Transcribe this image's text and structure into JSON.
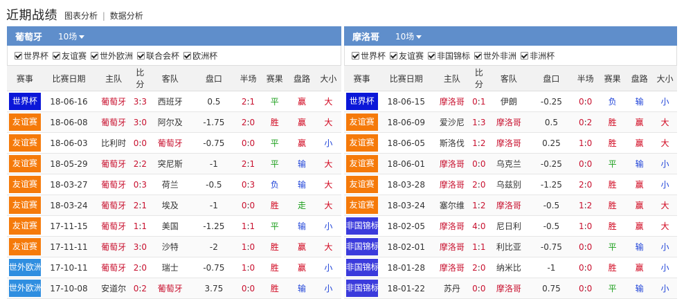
{
  "header": {
    "title": "近期战绩",
    "link1": "图表分析",
    "separator": "|",
    "link2": "数据分析"
  },
  "colors": {
    "header_bar": "#5f8ecb",
    "world_cup": "#0b17d8",
    "friendly": "#f57a0a",
    "wc_qual_europe": "#2f8ee0",
    "african_nations": "#3b3bdc",
    "win": "#d0021b",
    "draw": "#1a9e1a",
    "loss": "#1f43d8"
  },
  "panels": [
    {
      "team": "葡萄牙",
      "matches_label": "10场",
      "filters": [
        "世界杯",
        "友谊赛",
        "世外欧洲",
        "联合会杯",
        "欧洲杯"
      ],
      "columns": [
        "赛事",
        "比赛日期",
        "主队",
        "比分",
        "客队",
        "盘口",
        "半场",
        "赛果",
        "盘路",
        "大小"
      ],
      "rows": [
        {
          "league": "世界杯",
          "lc": "world_cup",
          "date": "18-06-16",
          "home": "葡萄牙",
          "hh": true,
          "s1": "3",
          "s2": "3",
          "away": "西班牙",
          "ah": false,
          "line": "0.5",
          "h1": "2",
          "h2": "1",
          "res": "平",
          "rc": "draw",
          "hcp": "赢",
          "hc": "win",
          "ou": "大",
          "oc": "win"
        },
        {
          "league": "友谊赛",
          "lc": "friendly",
          "date": "18-06-08",
          "home": "葡萄牙",
          "hh": true,
          "s1": "3",
          "s2": "0",
          "away": "阿尔及",
          "ah": false,
          "line": "-1.75",
          "h1": "2",
          "h2": "0",
          "res": "胜",
          "rc": "win",
          "hcp": "赢",
          "hc": "win",
          "ou": "大",
          "oc": "win"
        },
        {
          "league": "友谊赛",
          "lc": "friendly",
          "date": "18-06-03",
          "home": "比利时",
          "hh": false,
          "s1": "0",
          "s2": "0",
          "away": "葡萄牙",
          "ah": true,
          "line": "-0.75",
          "h1": "0",
          "h2": "0",
          "res": "平",
          "rc": "draw",
          "hcp": "赢",
          "hc": "win",
          "ou": "小",
          "oc": "loss"
        },
        {
          "league": "友谊赛",
          "lc": "friendly",
          "date": "18-05-29",
          "home": "葡萄牙",
          "hh": true,
          "s1": "2",
          "s2": "2",
          "away": "突尼斯",
          "ah": false,
          "line": "-1",
          "h1": "2",
          "h2": "1",
          "res": "平",
          "rc": "draw",
          "hcp": "输",
          "hc": "loss",
          "ou": "大",
          "oc": "win"
        },
        {
          "league": "友谊赛",
          "lc": "friendly",
          "date": "18-03-27",
          "home": "葡萄牙",
          "hh": true,
          "s1": "0",
          "s2": "3",
          "away": "荷兰",
          "ah": false,
          "line": "-0.5",
          "h1": "0",
          "h2": "3",
          "res": "负",
          "rc": "loss",
          "hcp": "输",
          "hc": "loss",
          "ou": "大",
          "oc": "win"
        },
        {
          "league": "友谊赛",
          "lc": "friendly",
          "date": "18-03-24",
          "home": "葡萄牙",
          "hh": true,
          "s1": "2",
          "s2": "1",
          "away": "埃及",
          "ah": false,
          "line": "-1",
          "h1": "0",
          "h2": "0",
          "res": "胜",
          "rc": "win",
          "hcp": "走",
          "hc": "draw",
          "ou": "大",
          "oc": "win"
        },
        {
          "league": "友谊赛",
          "lc": "friendly",
          "date": "17-11-15",
          "home": "葡萄牙",
          "hh": true,
          "s1": "1",
          "s2": "1",
          "away": "美国",
          "ah": false,
          "line": "-1.25",
          "h1": "1",
          "h2": "1",
          "res": "平",
          "rc": "draw",
          "hcp": "输",
          "hc": "loss",
          "ou": "小",
          "oc": "loss"
        },
        {
          "league": "友谊赛",
          "lc": "friendly",
          "date": "17-11-11",
          "home": "葡萄牙",
          "hh": true,
          "s1": "3",
          "s2": "0",
          "away": "沙特",
          "ah": false,
          "line": "-2",
          "h1": "1",
          "h2": "0",
          "res": "胜",
          "rc": "win",
          "hcp": "赢",
          "hc": "win",
          "ou": "大",
          "oc": "win"
        },
        {
          "league": "世外欧洲",
          "lc": "wc_qual_europe",
          "date": "17-10-11",
          "home": "葡萄牙",
          "hh": true,
          "s1": "2",
          "s2": "0",
          "away": "瑞士",
          "ah": false,
          "line": "-0.75",
          "h1": "1",
          "h2": "0",
          "res": "胜",
          "rc": "win",
          "hcp": "赢",
          "hc": "win",
          "ou": "小",
          "oc": "loss"
        },
        {
          "league": "世外欧洲",
          "lc": "wc_qual_europe",
          "date": "17-10-08",
          "home": "安道尔",
          "hh": false,
          "s1": "0",
          "s2": "2",
          "away": "葡萄牙",
          "ah": true,
          "line": "3.75",
          "h1": "0",
          "h2": "0",
          "res": "胜",
          "rc": "win",
          "hcp": "输",
          "hc": "loss",
          "ou": "小",
          "oc": "loss"
        }
      ]
    },
    {
      "team": "摩洛哥",
      "matches_label": "10场",
      "filters": [
        "世界杯",
        "友谊赛",
        "非国锦标",
        "世外非洲",
        "非洲杯"
      ],
      "columns": [
        "赛事",
        "比赛日期",
        "主队",
        "比分",
        "客队",
        "盘口",
        "半场",
        "赛果",
        "盘路",
        "大小"
      ],
      "rows": [
        {
          "league": "世界杯",
          "lc": "world_cup",
          "date": "18-06-15",
          "home": "摩洛哥",
          "hh": true,
          "s1": "0",
          "s2": "1",
          "away": "伊朗",
          "ah": false,
          "line": "-0.25",
          "h1": "0",
          "h2": "0",
          "res": "负",
          "rc": "loss",
          "hcp": "输",
          "hc": "loss",
          "ou": "小",
          "oc": "loss"
        },
        {
          "league": "友谊赛",
          "lc": "friendly",
          "date": "18-06-09",
          "home": "爱沙尼",
          "hh": false,
          "s1": "1",
          "s2": "3",
          "away": "摩洛哥",
          "ah": true,
          "line": "0.5",
          "h1": "0",
          "h2": "2",
          "res": "胜",
          "rc": "win",
          "hcp": "赢",
          "hc": "win",
          "ou": "大",
          "oc": "win"
        },
        {
          "league": "友谊赛",
          "lc": "friendly",
          "date": "18-06-05",
          "home": "斯洛伐",
          "hh": false,
          "s1": "1",
          "s2": "2",
          "away": "摩洛哥",
          "ah": true,
          "line": "0.25",
          "h1": "1",
          "h2": "0",
          "res": "胜",
          "rc": "win",
          "hcp": "赢",
          "hc": "win",
          "ou": "大",
          "oc": "win"
        },
        {
          "league": "友谊赛",
          "lc": "friendly",
          "date": "18-06-01",
          "home": "摩洛哥",
          "hh": true,
          "s1": "0",
          "s2": "0",
          "away": "乌克兰",
          "ah": false,
          "line": "-0.25",
          "h1": "0",
          "h2": "0",
          "res": "平",
          "rc": "draw",
          "hcp": "输",
          "hc": "loss",
          "ou": "小",
          "oc": "loss"
        },
        {
          "league": "友谊赛",
          "lc": "friendly",
          "date": "18-03-28",
          "home": "摩洛哥",
          "hh": true,
          "s1": "2",
          "s2": "0",
          "away": "乌兹别",
          "ah": false,
          "line": "-1.25",
          "h1": "2",
          "h2": "0",
          "res": "胜",
          "rc": "win",
          "hcp": "赢",
          "hc": "win",
          "ou": "小",
          "oc": "loss"
        },
        {
          "league": "友谊赛",
          "lc": "friendly",
          "date": "18-03-24",
          "home": "塞尔维",
          "hh": false,
          "s1": "1",
          "s2": "2",
          "away": "摩洛哥",
          "ah": true,
          "line": "-0.5",
          "h1": "1",
          "h2": "2",
          "res": "胜",
          "rc": "win",
          "hcp": "赢",
          "hc": "win",
          "ou": "大",
          "oc": "win"
        },
        {
          "league": "非国锦标",
          "lc": "african_nations",
          "date": "18-02-05",
          "home": "摩洛哥",
          "hh": true,
          "s1": "4",
          "s2": "0",
          "away": "尼日利",
          "ah": false,
          "line": "-0.5",
          "h1": "1",
          "h2": "0",
          "res": "胜",
          "rc": "win",
          "hcp": "赢",
          "hc": "win",
          "ou": "大",
          "oc": "win"
        },
        {
          "league": "非国锦标",
          "lc": "african_nations",
          "date": "18-02-01",
          "home": "摩洛哥",
          "hh": true,
          "s1": "1",
          "s2": "1",
          "away": "利比亚",
          "ah": false,
          "line": "-0.75",
          "h1": "0",
          "h2": "0",
          "res": "平",
          "rc": "draw",
          "hcp": "输",
          "hc": "loss",
          "ou": "小",
          "oc": "loss"
        },
        {
          "league": "非国锦标",
          "lc": "african_nations",
          "date": "18-01-28",
          "home": "摩洛哥",
          "hh": true,
          "s1": "2",
          "s2": "0",
          "away": "纳米比",
          "ah": false,
          "line": "-1",
          "h1": "0",
          "h2": "0",
          "res": "胜",
          "rc": "win",
          "hcp": "赢",
          "hc": "win",
          "ou": "小",
          "oc": "loss"
        },
        {
          "league": "非国锦标",
          "lc": "african_nations",
          "date": "18-01-22",
          "home": "苏丹",
          "hh": false,
          "s1": "0",
          "s2": "0",
          "away": "摩洛哥",
          "ah": true,
          "line": "0.75",
          "h1": "0",
          "h2": "0",
          "res": "平",
          "rc": "draw",
          "hcp": "输",
          "hc": "loss",
          "ou": "小",
          "oc": "loss"
        }
      ]
    }
  ]
}
